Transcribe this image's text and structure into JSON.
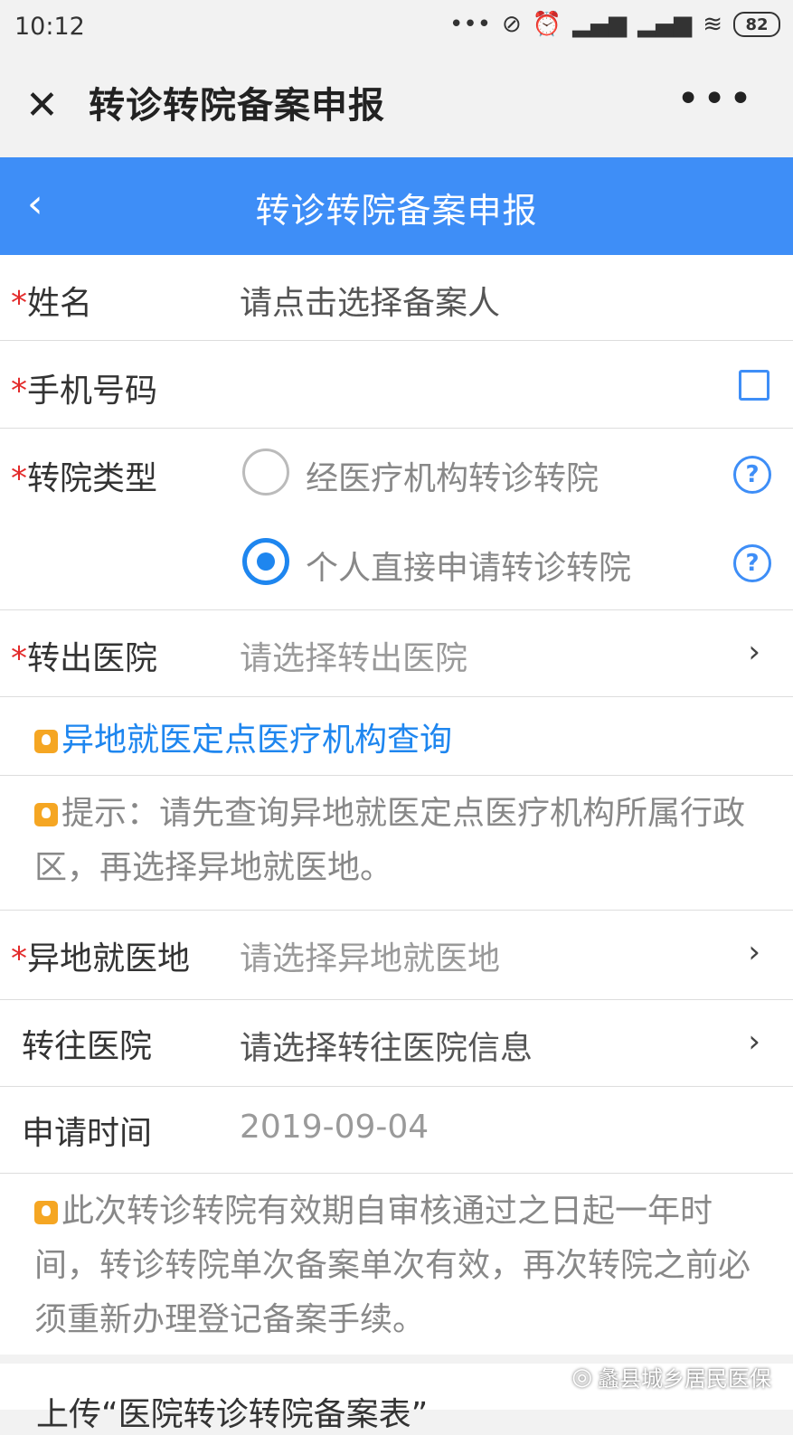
{
  "status_bar": {
    "time": "10:12",
    "dots": "•••",
    "battery": "82"
  },
  "app_header": {
    "title": "转诊转院备案申报",
    "more": "•••"
  },
  "nav": {
    "title": "转诊转院备案申报"
  },
  "form": {
    "name": {
      "label": "姓名",
      "placeholder": "请点击选择备案人"
    },
    "phone": {
      "label": "手机号码"
    },
    "transfer_type": {
      "label": "转院类型",
      "options": [
        {
          "label": "经医疗机构转诊转院",
          "selected": false
        },
        {
          "label": "个人直接申请转诊转院",
          "selected": true
        }
      ]
    },
    "out_hospital": {
      "label": "转出医院",
      "placeholder": "请选择转出医院"
    },
    "query_link": "异地就医定点医疗机构查询",
    "tip1": "提示：请先查询异地就医定点医疗机构所属行政区，再选择异地就医地。",
    "medical_location": {
      "label": "异地就医地",
      "placeholder": "请选择异地就医地"
    },
    "target_hospital": {
      "label": "转往医院",
      "placeholder": "请选择转往医院信息"
    },
    "apply_time": {
      "label": "申请时间",
      "value": "2019-09-04"
    },
    "tip2": "此次转诊转院有效期自审核通过之日起一年时间，转诊转院单次备案单次有效，再次转院之前必须重新办理登记备案手续。"
  },
  "bottom": {
    "text": "上传“医院转诊转院备案表”",
    "watermark": "蠡县城乡居民医保"
  },
  "colors": {
    "nav_blue": "#3e8ef7",
    "required_star": "#e32b2b",
    "link_blue": "#1e86ef",
    "tip_icon": "#f5a623"
  }
}
